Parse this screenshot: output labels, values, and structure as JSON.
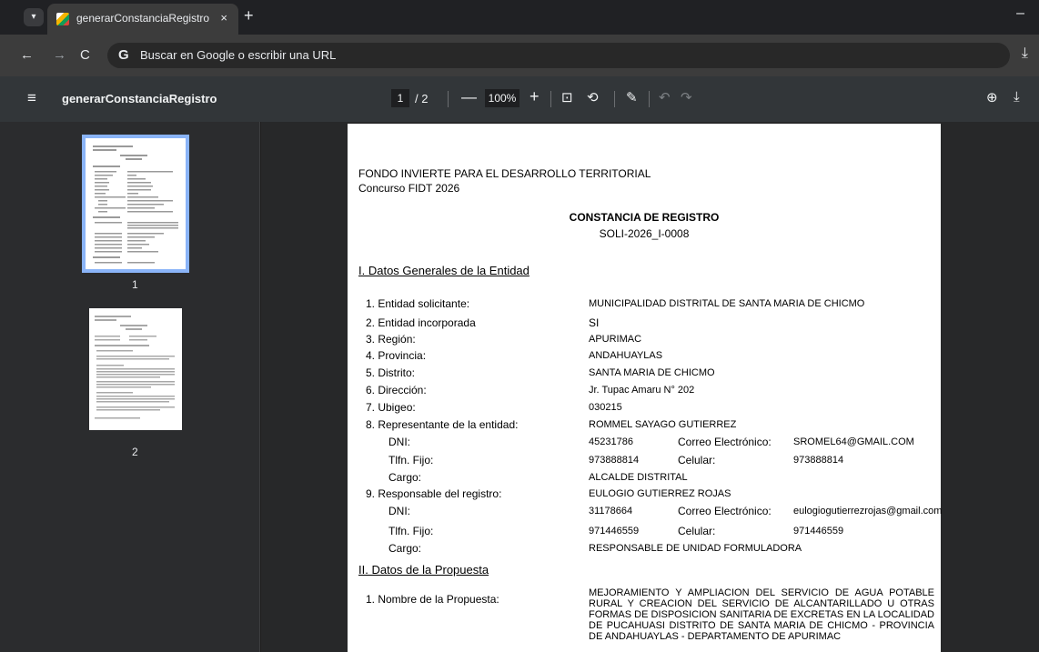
{
  "browser": {
    "tab_title": "generarConstanciaRegistro",
    "tab_close": "×",
    "new_tab": "+",
    "minimize": "–",
    "omnibox_placeholder": "Buscar en Google o escribir una URL",
    "nav_back": "←",
    "nav_forward": "→",
    "nav_reload": "C",
    "google_g": "G",
    "download": "⤓"
  },
  "pdf_toolbar": {
    "menu": "≡",
    "title": "generarConstanciaRegistro",
    "current_page": "1",
    "page_total": "/ 2",
    "zoom_out": "—",
    "zoom": "100%",
    "zoom_in": "+",
    "fit": "⊡",
    "rotate": "⟲",
    "annotate": "✎",
    "undo": "↶",
    "redo": "↷",
    "save_drive": "⊕",
    "download": "⤓"
  },
  "sidebar": {
    "thumbs": [
      {
        "label": "1"
      },
      {
        "label": "2"
      }
    ]
  },
  "document": {
    "org": "FONDO INVIERTE PARA EL DESARROLLO TERRITORIAL",
    "contest": "Concurso FIDT 2026",
    "heading": "CONSTANCIA DE REGISTRO",
    "code": "SOLI-2026_I-0008",
    "section1": "I. Datos Generales de la Entidad",
    "section2": "II. Datos de la Propuesta",
    "fields": [
      {
        "label": "1. Entidad solicitante:",
        "value": "MUNICIPALIDAD DISTRITAL DE SANTA MARIA DE CHICMO"
      },
      {
        "label": "2. Entidad incorporada",
        "value": "SI"
      },
      {
        "label": "3. Región:",
        "value": "APURIMAC"
      },
      {
        "label": "4. Provincia:",
        "value": "ANDAHUAYLAS"
      },
      {
        "label": "5. Distrito:",
        "value": "SANTA MARIA DE CHICMO"
      },
      {
        "label": "6. Dirección:",
        "value": "Jr. Tupac Amaru N° 202"
      },
      {
        "label": "7. Ubigeo:",
        "value": "030215"
      },
      {
        "label": "8. Representante de la entidad:",
        "value": "ROMMEL SAYAGO GUTIERREZ"
      }
    ],
    "rep": {
      "dni_label": "DNI:",
      "dni": "45231786",
      "email_label": "Correo Electrónico:",
      "email": "SROMEL64@GMAIL.COM",
      "phone_label": "Tlfn. Fijo:",
      "phone": "973888814",
      "cell_label": "Celular:",
      "cell": "973888814",
      "role_label": "Cargo:",
      "role": "ALCALDE DISTRITAL"
    },
    "resp_label": "9. Responsable del registro:",
    "resp_value": "EULOGIO GUTIERREZ ROJAS",
    "resp": {
      "dni_label": "DNI:",
      "dni": "31178664",
      "email_label": "Correo Electrónico:",
      "email": "eulogiogutierrezrojas@gmail.com",
      "phone_label": "Tlfn. Fijo:",
      "phone": "971446559",
      "cell_label": "Celular:",
      "cell": "971446559",
      "role_label": "Cargo:",
      "role": "RESPONSABLE DE UNIDAD FORMULADORA"
    },
    "proposal_label": "1. Nombre de la Propuesta:",
    "proposal_value": "MEJORAMIENTO Y AMPLIACION DEL SERVICIO DE AGUA POTABLE RURAL Y CREACION DEL SERVICIO DE ALCANTARILLADO U OTRAS FORMAS DE DISPOSICION SANITARIA DE EXCRETAS EN LA LOCALIDAD DE PUCAHUASI DISTRITO DE SANTA MARIA DE CHICMO - PROVINCIA DE ANDAHUAYLAS - DEPARTAMENTO DE APURIMAC"
  }
}
